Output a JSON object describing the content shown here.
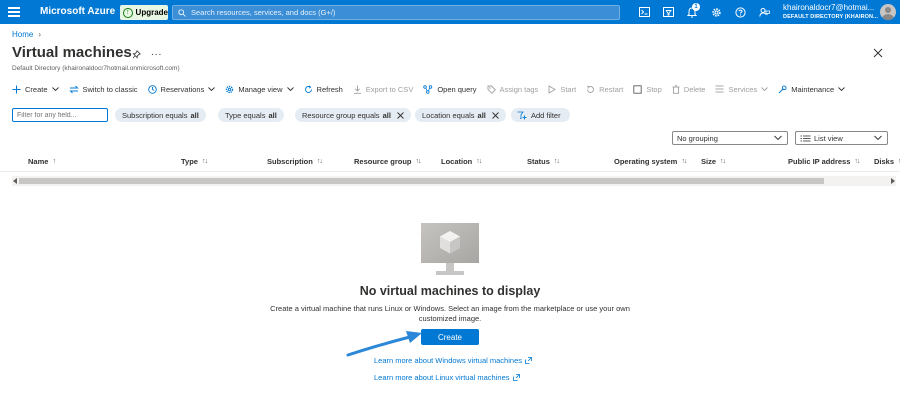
{
  "topbar": {
    "brand": "Microsoft Azure",
    "upgrade_label": "Upgrade",
    "search_placeholder": "Search resources, services, and docs (G+/)",
    "notification_count": "1",
    "account_name": "khaironaldocr7@hotmai...",
    "account_directory": "DEFAULT DIRECTORY (KHAIRON...",
    "icons": [
      "cloud-shell-icon",
      "directory-filter-icon",
      "notifications-icon",
      "settings-icon",
      "help-icon",
      "feedback-icon"
    ],
    "color": "#0078d4"
  },
  "header": {
    "breadcrumb_home": "Home",
    "title": "Virtual machines",
    "ellipsis": "...",
    "subtitle": "Default Directory (khaironaldocr7hotmail.onmicrosoft.com)"
  },
  "toolbar": {
    "create": "Create",
    "switch_classic": "Switch to classic",
    "reservations": "Reservations",
    "manage_view": "Manage view",
    "refresh": "Refresh",
    "export_csv": "Export to CSV",
    "open_query": "Open query",
    "assign_tags": "Assign tags",
    "start": "Start",
    "restart": "Restart",
    "stop": "Stop",
    "delete": "Delete",
    "services": "Services",
    "maintenance": "Maintenance"
  },
  "filters": {
    "filter_placeholder": "Filter for any field...",
    "subscription": {
      "label": "Subscription equals",
      "value": "all"
    },
    "type": {
      "label": "Type equals",
      "value": "all"
    },
    "resource_group": {
      "label": "Resource group equals",
      "value": "all"
    },
    "location": {
      "label": "Location equals",
      "value": "all"
    },
    "add_filter": "Add filter",
    "grouping": "No grouping",
    "view": "List view"
  },
  "table": {
    "columns": [
      "Name",
      "Type",
      "Subscription",
      "Resource group",
      "Location",
      "Status",
      "Operating system",
      "Size",
      "Public IP address",
      "Disks"
    ],
    "sort_glyph": "↑↓",
    "name_sort_glyph": "↑"
  },
  "empty_state": {
    "title": "No virtual machines to display",
    "description": "Create a virtual machine that runs Linux or Windows. Select an image from the marketplace or use your own customized image.",
    "create_button": "Create",
    "learn_windows": "Learn more about Windows virtual machines",
    "learn_linux": "Learn more about Linux virtual machines",
    "accent": "#0078d4"
  }
}
